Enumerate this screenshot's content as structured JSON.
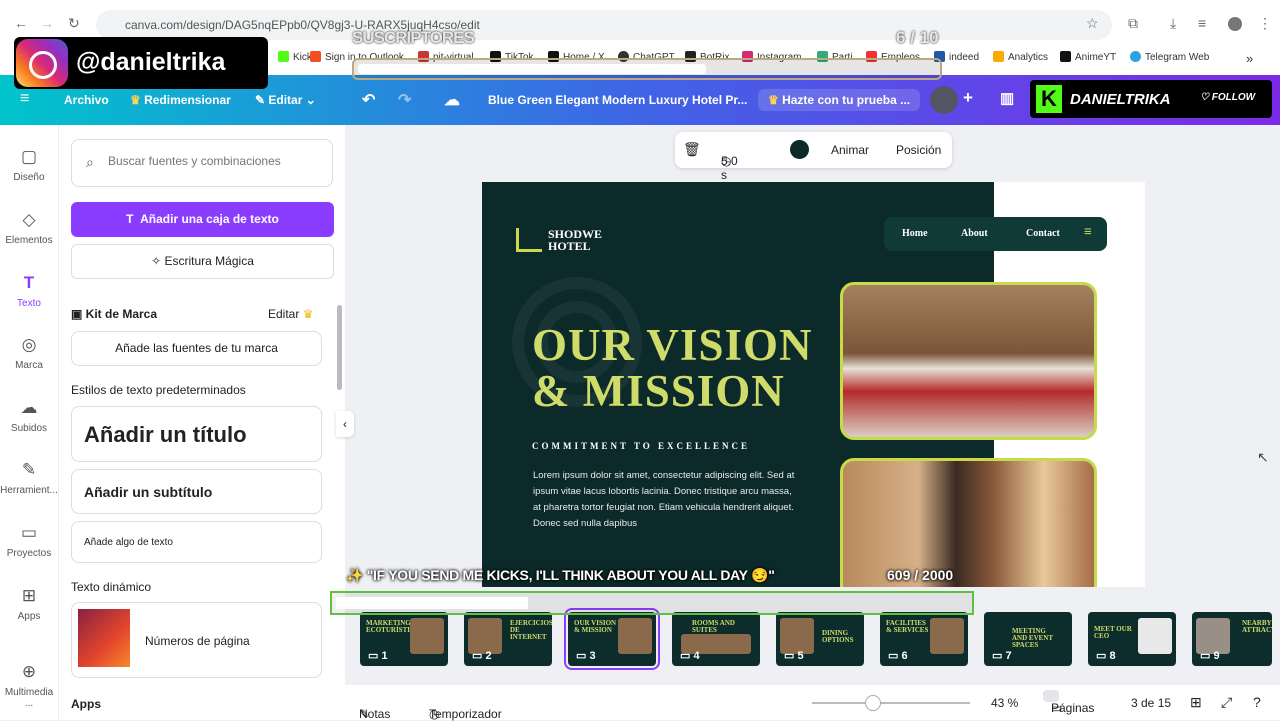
{
  "browser": {
    "url": "canva.com/design/DAG5nqEPpb0/QV8gj3-U-RARX5juqH4cso/edit",
    "bookmarks": [
      "Kick",
      "Sign in to Outlook",
      "pit-virtual",
      "TikTok",
      "Home / X",
      "ChatGPT",
      "BotRix",
      "Instagram",
      "Parti",
      "Empleos",
      "indeed",
      "Analytics",
      "AnimeYT",
      "Telegram Web"
    ]
  },
  "overlay": {
    "instagram_handle": "@danieltrika",
    "subs_label": "SUSCRIPTORES",
    "subs_count": "6 / 10",
    "subs_fraction": 0.6,
    "kick_name": "DANIELTRIKA",
    "follow_label": "FOLLOW",
    "kick_message": "✨ \"IF YOU SEND ME KICKS, I'LL THINK ABOUT YOU ALL DAY 😏\"",
    "kick_count": "609 / 2000",
    "kick_fraction": 0.3045
  },
  "toolbar": {
    "file": "Archivo",
    "resize": "Redimensionar",
    "edit": "Editar",
    "title": "Blue Green Elegant Modern Luxury Hotel Pr...",
    "trial": "Hazte con tu prueba ..."
  },
  "rail": [
    {
      "icon": "design-icon",
      "label": "Diseño",
      "glyph": "▢"
    },
    {
      "icon": "elements-icon",
      "label": "Elementos",
      "glyph": "◇"
    },
    {
      "icon": "text-icon",
      "label": "Texto",
      "glyph": "T"
    },
    {
      "icon": "brand-icon",
      "label": "Marca",
      "glyph": "◎"
    },
    {
      "icon": "uploads-icon",
      "label": "Subidos",
      "glyph": "☁"
    },
    {
      "icon": "tools-icon",
      "label": "Herramient...",
      "glyph": "✎"
    },
    {
      "icon": "projects-icon",
      "label": "Proyectos",
      "glyph": "▭"
    },
    {
      "icon": "apps-icon",
      "label": "Apps",
      "glyph": "⊞"
    },
    {
      "icon": "media-icon",
      "label": "Multimedia ...",
      "glyph": "⊕"
    }
  ],
  "panel": {
    "search_placeholder": "Buscar fuentes y combinaciones",
    "add_textbox": "Añadir una caja de texto",
    "magic_write": "Escritura Mágica",
    "brand_kit": "Kit de Marca",
    "brand_edit": "Editar",
    "brand_fonts": "Añade las fuentes de tu marca",
    "default_styles": "Estilos de texto predeterminados",
    "add_title": "Añadir un título",
    "add_subtitle": "Añadir un subtítulo",
    "add_body": "Añade algo de texto",
    "dynamic_text": "Texto dinámico",
    "page_numbers": "Números de página",
    "apps": "Apps"
  },
  "context": {
    "duration": "5.0 s",
    "animate": "Animar",
    "position": "Posición",
    "color": "#0c2a2a"
  },
  "slide": {
    "brand": "SHODWE HOTEL",
    "nav": [
      "Home",
      "About",
      "Contact"
    ],
    "heading1": "OUR VISION",
    "heading2": "& MISSION",
    "subheading": "COMMITMENT TO EXCELLENCE",
    "body": "Lorem ipsum dolor sit amet, consectetur adipiscing elit. Sed at ipsum vitae lacus lobortis lacinia. Donec tristique arcu massa, at pharetra tortor feugiat non. Etiam vehicula hendrerit aliquet. Donec sed nulla dapibus"
  },
  "thumbnails": [
    {
      "title": "MARKETING ECOTURÍSTICO",
      "num": "1"
    },
    {
      "title": "EJERCICIOS DE INTERNET",
      "num": "2"
    },
    {
      "title": "OUR VISION & MISSION",
      "num": "3"
    },
    {
      "title": "ROOMS AND SUITES",
      "num": "4"
    },
    {
      "title": "DINING OPTIONS",
      "num": "5"
    },
    {
      "title": "FACILITIES & SERVICES",
      "num": "6"
    },
    {
      "title": "MEETING AND EVENT SPACES",
      "num": "7"
    },
    {
      "title": "MEET OUR CEO",
      "num": "8"
    },
    {
      "title": "NEARBY ATTRACTIONS",
      "num": "9"
    }
  ],
  "footer": {
    "notes": "Notas",
    "timer": "Temporizador",
    "zoom": "43 %",
    "pages": "Páginas",
    "page_count": "3 de 15"
  }
}
